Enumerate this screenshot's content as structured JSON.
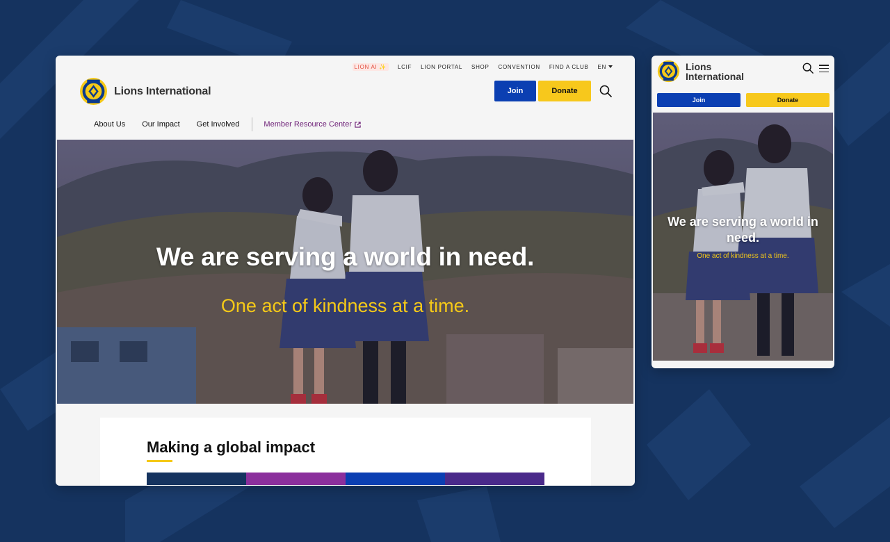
{
  "brand": {
    "name": "Lions International",
    "name_line1": "Lions",
    "name_line2": "International",
    "colors": {
      "blue": "#0b3fb2",
      "gold": "#f7c81c",
      "purple": "#6d2077",
      "navy": "#15335f"
    }
  },
  "utility_nav": {
    "items": [
      "LION AI ✨",
      "LCIF",
      "LION PORTAL",
      "SHOP",
      "CONVENTION",
      "FIND A CLUB"
    ],
    "language": "EN"
  },
  "header": {
    "join_label": "Join",
    "donate_label": "Donate",
    "search_icon": "search-icon",
    "menu_icon": "hamburger-menu-icon"
  },
  "main_nav": {
    "items": [
      "About Us",
      "Our Impact",
      "Get Involved"
    ],
    "member_center": "Member Resource Center",
    "external_icon": "external-link-icon"
  },
  "hero": {
    "headline": "We are serving a world in need.",
    "tagline": "One act of kindness at a time."
  },
  "impact": {
    "title": "Making a global impact",
    "bar_colors": [
      "#15335f",
      "#8b2f9c",
      "#0b3fb2",
      "#4a2a8a"
    ]
  }
}
